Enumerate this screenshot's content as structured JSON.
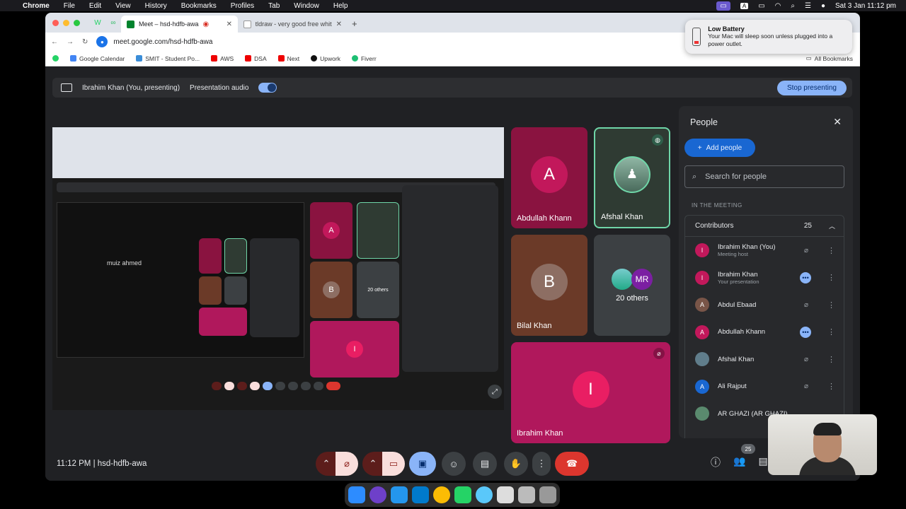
{
  "menubar": {
    "app": "Chrome",
    "items": [
      "File",
      "Edit",
      "View",
      "History",
      "Bookmarks",
      "Profiles",
      "Tab",
      "Window",
      "Help"
    ],
    "clock": "Sat 3 Jan  11:12 pm"
  },
  "browser": {
    "tabs": [
      {
        "label": "Meet – hsd-hdfb-awa",
        "active": true
      },
      {
        "label": "tldraw - very good free white",
        "active": false
      }
    ],
    "url": "meet.google.com/hsd-hdfb-awa",
    "bookmarks": [
      "Google Calendar",
      "SMIT - Student Po...",
      "AWS",
      "DSA",
      "Next",
      "Upwork",
      "Fiverr"
    ],
    "all_bookmarks": "All Bookmarks"
  },
  "notification": {
    "title": "Low Battery",
    "body": "Your Mac will sleep soon unless plugged into a power outlet."
  },
  "present_bar": {
    "presenter": "Ibrahim Khan (You, presenting)",
    "audio_label": "Presentation audio",
    "stop_label": "Stop presenting"
  },
  "tiles": [
    {
      "name": "Abdullah Khann",
      "initial": "A",
      "color": "#8a1340"
    },
    {
      "name": "Afshal Khan",
      "initial": "",
      "color": "#2f3b33"
    },
    {
      "name": "Bilal Khan",
      "initial": "B",
      "color": "#6b3a28"
    },
    {
      "name": "20 others",
      "initial": "MR",
      "color": "#3c4043"
    },
    {
      "name": "Ibrahim Khan",
      "initial": "I",
      "color": "#b0185c"
    }
  ],
  "people_panel": {
    "title": "People",
    "add_label": "Add people",
    "search_placeholder": "Search for people",
    "section": "IN THE MEETING",
    "group_label": "Contributors",
    "group_count": "25",
    "people": [
      {
        "name": "Ibrahim Khan (You)",
        "sub": "Meeting host",
        "initial": "I",
        "color": "#c2185b"
      },
      {
        "name": "Ibrahim Khan",
        "sub": "Your presentation",
        "initial": "I",
        "color": "#c2185b"
      },
      {
        "name": "Abdul Ebaad",
        "sub": "",
        "initial": "A",
        "color": "#795548"
      },
      {
        "name": "Abdullah Khann",
        "sub": "",
        "initial": "A",
        "color": "#c2185b"
      },
      {
        "name": "Afshal Khan",
        "sub": "",
        "initial": "",
        "color": "#607d8b"
      },
      {
        "name": "Ali Rajput",
        "sub": "",
        "initial": "A",
        "color": "#1967d2"
      },
      {
        "name": "AR GHAZI (AR GHAZI)",
        "sub": "",
        "initial": "",
        "color": "#5a8a6e"
      }
    ]
  },
  "bottom": {
    "time": "11:12 PM",
    "code": "hsd-hdfb-awa",
    "participants_badge": "25"
  },
  "shared_screen": {
    "caption": "muiz ahmed",
    "others": "20 others"
  }
}
